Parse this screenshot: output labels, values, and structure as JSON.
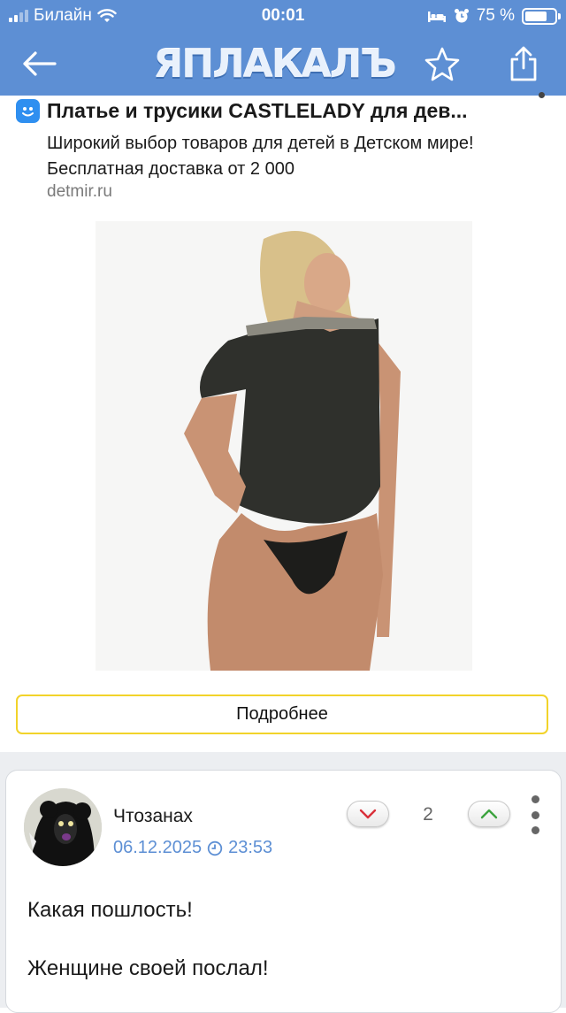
{
  "status_bar": {
    "carrier": "Билайн",
    "time": "00:01",
    "battery": "75 %",
    "battery_level": 0.75
  },
  "navbar": {
    "logo": "ЯПЛАКАЛЪ",
    "back_icon": "back-arrow-icon",
    "favorite_icon": "star-icon",
    "share_icon": "share-icon"
  },
  "ad": {
    "title": "Платье и трусики CASTLELADY для дев...",
    "text_line1": "Широкий выбор товаров для детей в Детском мире!",
    "text_line2": "Бесплатная доставка от 2 000",
    "domain": "detmir.ru",
    "button_label": "Подробнее",
    "button_border_color": "#f2d32a"
  },
  "comment": {
    "author": "Чтозанах",
    "date": "06.12.2025",
    "time": "23:53",
    "rating": "2",
    "paragraph1": "Какая пошлость!",
    "paragraph2": "Женщине своей послал!"
  },
  "colors": {
    "header_blue": "#5d8fd4",
    "link_blue": "#5d8fd4"
  }
}
